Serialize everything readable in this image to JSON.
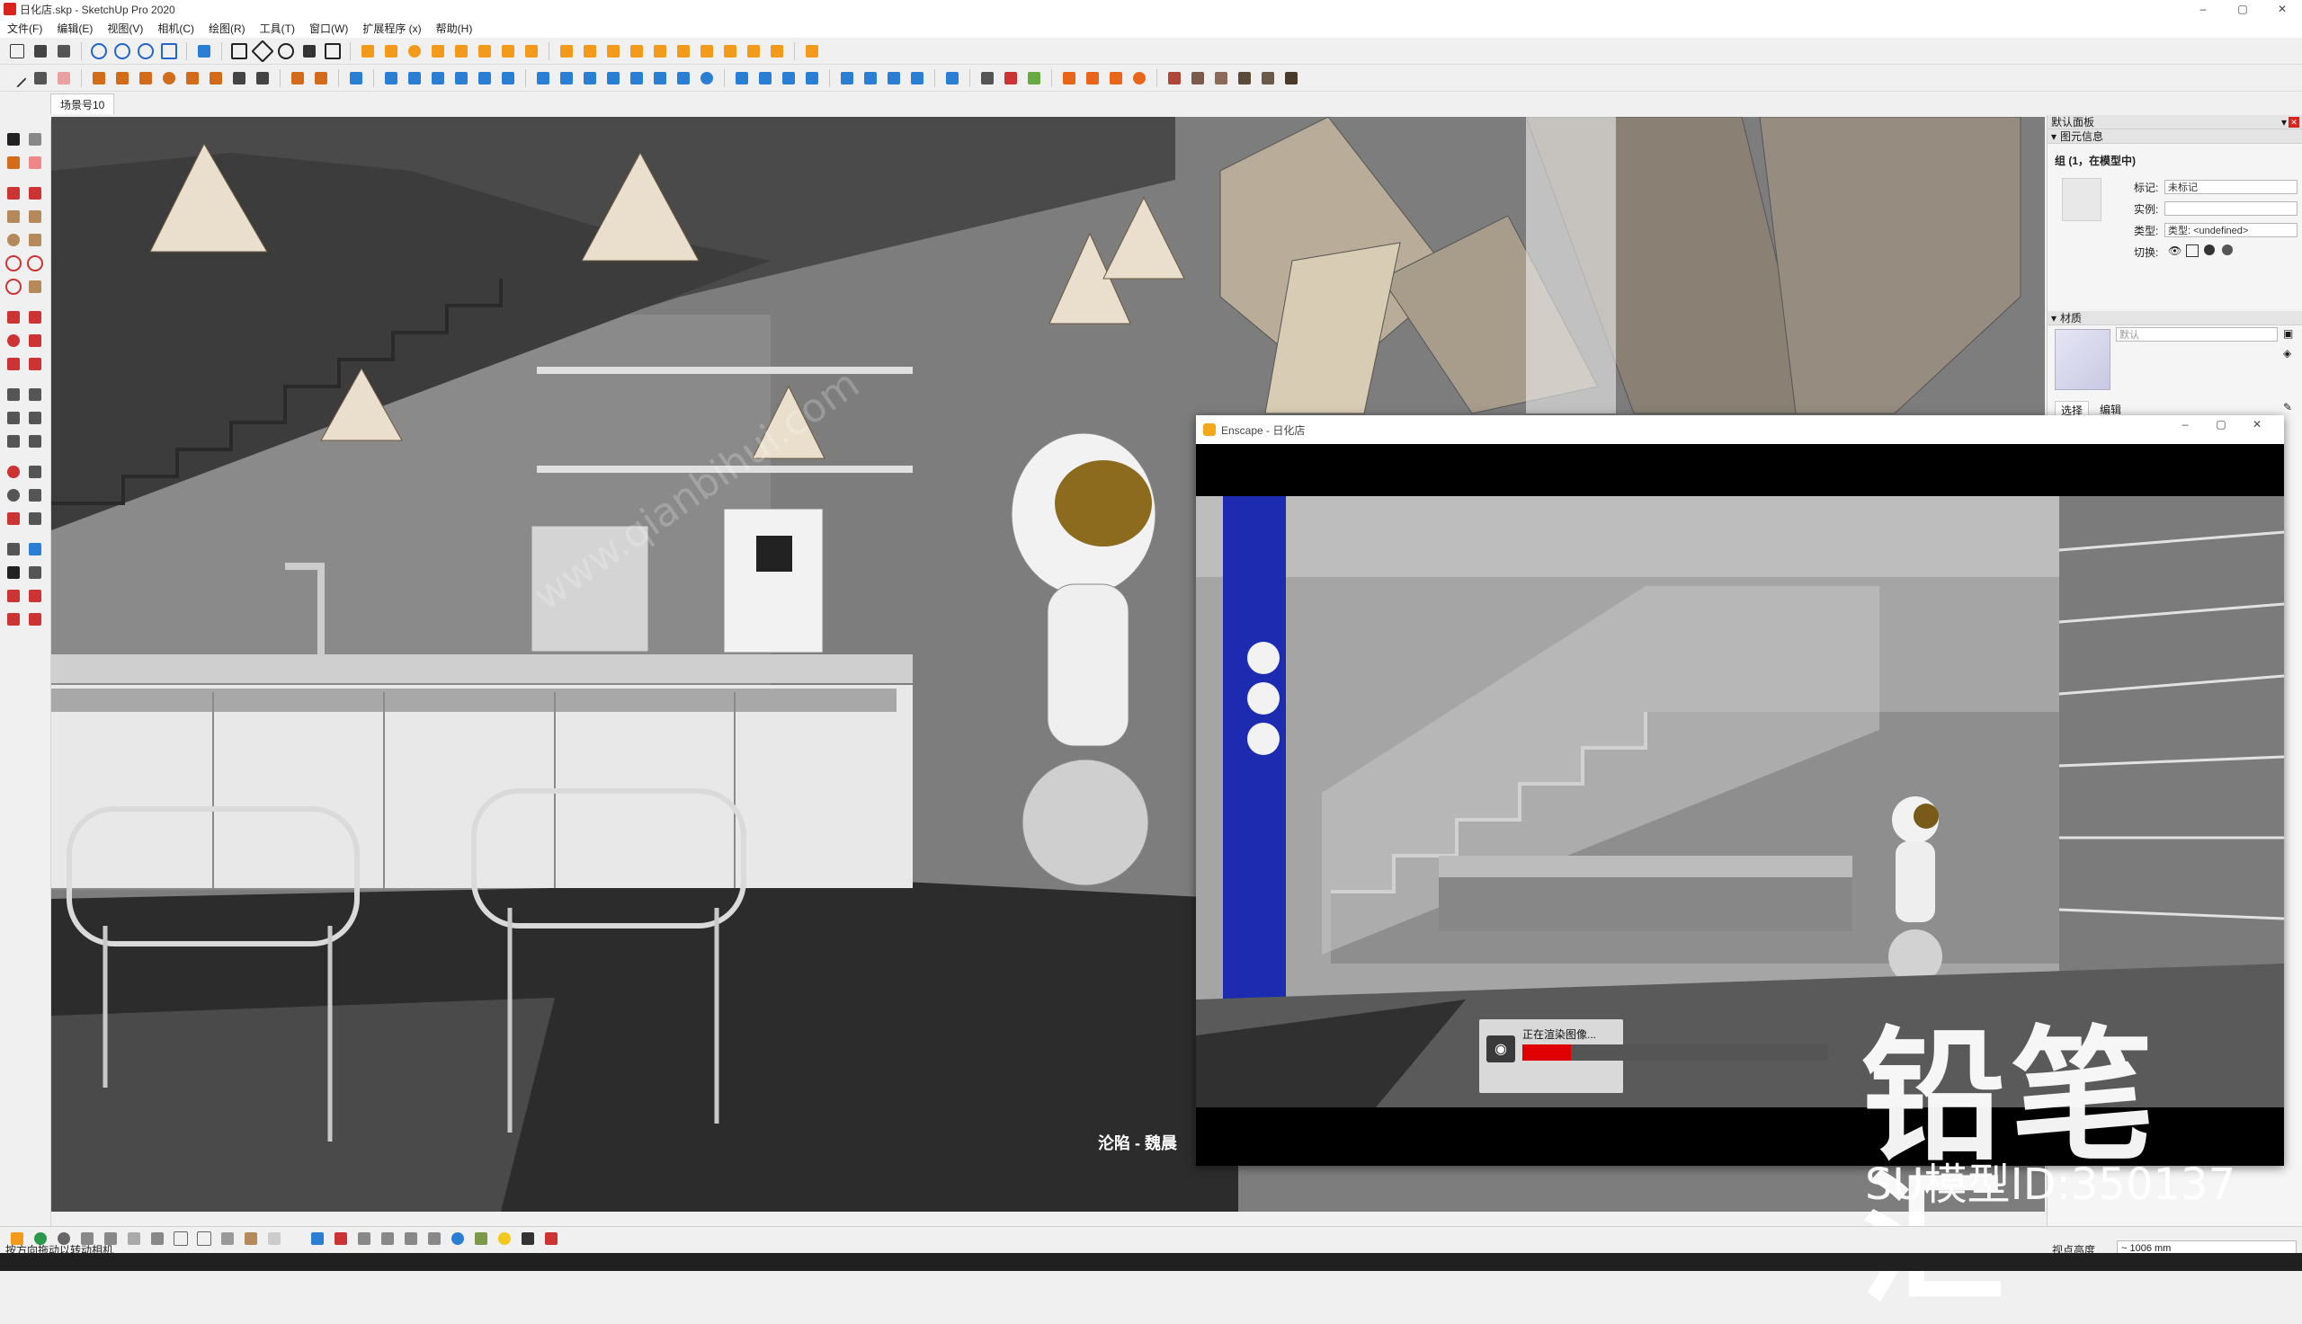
{
  "window": {
    "title": "日化店.skp - SketchUp Pro 2020",
    "controls": {
      "minimize": "–",
      "maximize": "▢",
      "close": "✕"
    }
  },
  "menu": [
    "文件(F)",
    "编辑(E)",
    "视图(V)",
    "相机(C)",
    "绘图(R)",
    "工具(T)",
    "窗口(W)",
    "扩展程序 (x)",
    "帮助(H)"
  ],
  "scene_tab": "场景号10",
  "right_panel": {
    "tray_title": "默认面板",
    "entity_info": {
      "header": "图元信息",
      "group_title": "组 (1，在模型中)",
      "tag_label": "标记:",
      "tag_value": "未标记",
      "instance_label": "实例:",
      "instance_value": "",
      "type_label": "类型:",
      "type_value": "类型: <undefined>",
      "toggle_label": "切换:"
    },
    "materials": {
      "header": "材质",
      "name_placeholder": "默认",
      "tab_select": "选择",
      "tab_edit": "编辑"
    }
  },
  "enscape": {
    "title": "Enscape - 日化店",
    "status_text": "正在渲染图像...",
    "progress_fraction": 0.16
  },
  "viewport_credit": "沦陷 - 魏晨",
  "status": {
    "hint": "按方向拖动以转动相机",
    "vcb_label": "视点高度",
    "vcb_value": "~ 1006 mm"
  },
  "watermark": {
    "brand": "铅笔汇",
    "model_id": "SU模型ID:350137",
    "site": "www.qianbihui.com"
  },
  "colors": {
    "brand_red": "#d9231d",
    "progress_red": "#e00000",
    "viewport_gray": "#7a7a7a"
  }
}
